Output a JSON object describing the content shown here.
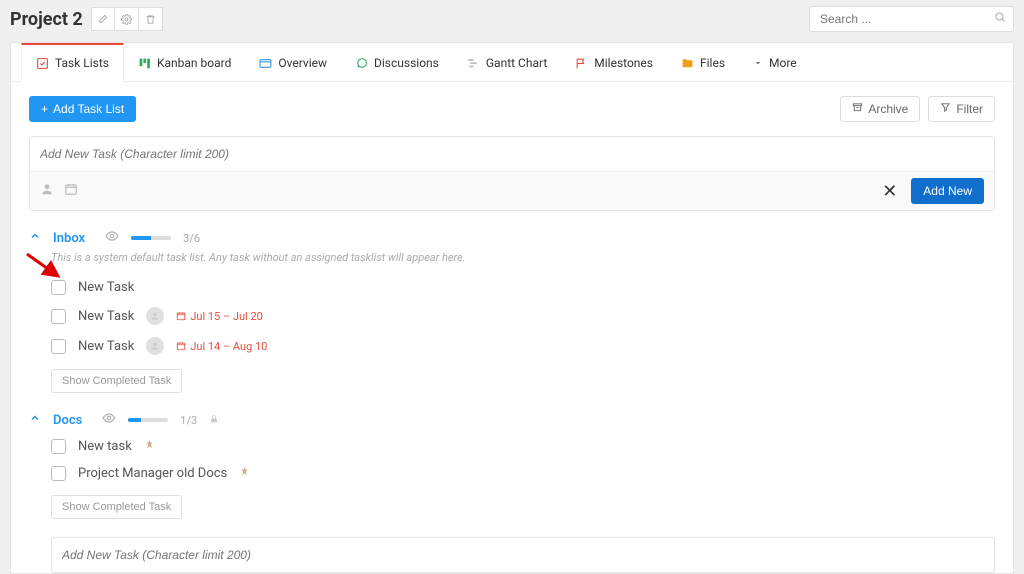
{
  "project": {
    "title": "Project 2"
  },
  "search": {
    "placeholder": "Search ..."
  },
  "tabs": {
    "task_lists": "Task Lists",
    "kanban": "Kanban board",
    "overview": "Overview",
    "discussions": "Discussions",
    "gantt": "Gantt Chart",
    "milestones": "Milestones",
    "files": "Files",
    "more": "More"
  },
  "actions": {
    "add_task_list": "Add Task List",
    "archive": "Archive",
    "filter": "Filter",
    "add_new": "Add New"
  },
  "new_task": {
    "placeholder": "Add New Task (Character limit 200)"
  },
  "lists": {
    "inbox": {
      "title": "Inbox",
      "count": "3/6",
      "progress_pct": 50,
      "desc": "This is a system default task list. Any task without an assigned tasklist will appear here.",
      "tasks": [
        {
          "text": "New Task"
        },
        {
          "text": "New Task",
          "date": "Jul 15 – Jul 20"
        },
        {
          "text": "New Task",
          "date": "Jul 14 – Aug 10"
        }
      ],
      "show_completed": "Show Completed Task"
    },
    "docs": {
      "title": "Docs",
      "count": "1/3",
      "progress_pct": 33,
      "tasks": [
        {
          "text": "New task"
        },
        {
          "text": "Project Manager old Docs"
        }
      ],
      "show_completed": "Show Completed Task"
    }
  }
}
